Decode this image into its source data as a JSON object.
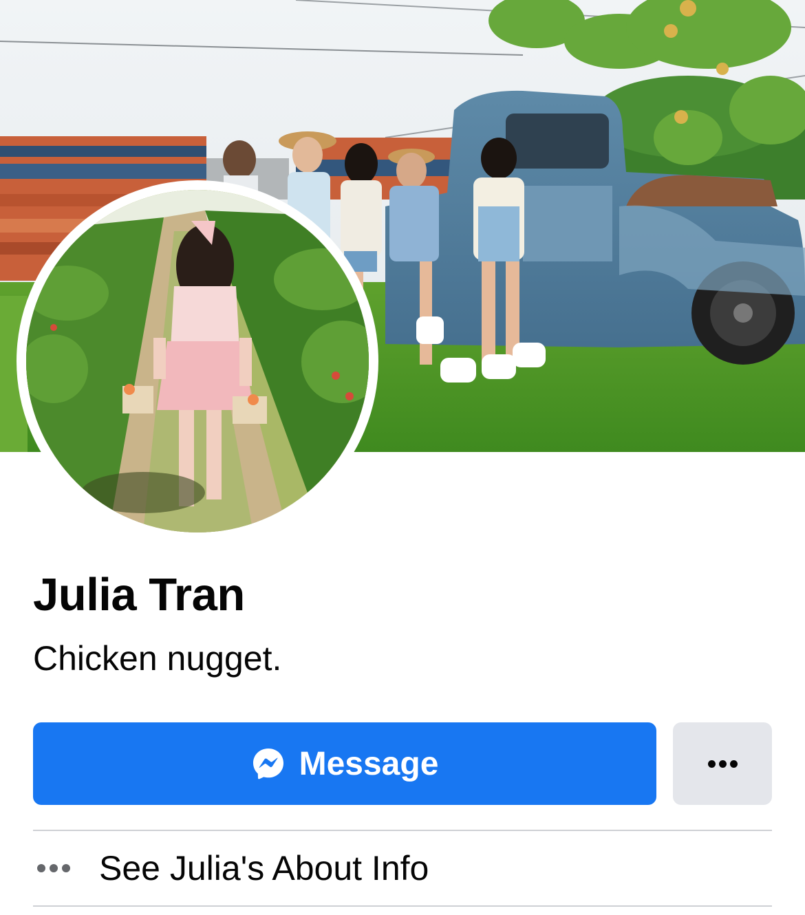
{
  "profile": {
    "name": "Julia Tran",
    "bio": "Chicken nugget."
  },
  "actions": {
    "message_label": "Message",
    "message_icon": "messenger-icon",
    "more_icon": "more-dots-icon"
  },
  "about": {
    "label": "See Julia's About Info",
    "icon": "more-dots-icon"
  },
  "colors": {
    "primary": "#1877f2",
    "secondary_button": "#e4e6eb",
    "divider": "#ced0d4",
    "text": "#050505",
    "muted_icon": "#65676b"
  }
}
